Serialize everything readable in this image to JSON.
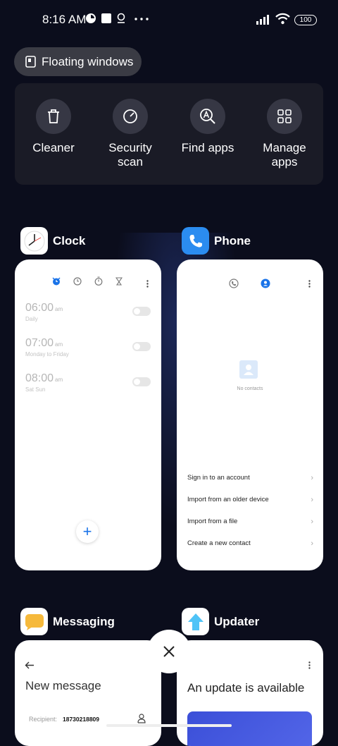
{
  "status_bar": {
    "time": "8:16 AM",
    "battery": "100"
  },
  "floating_windows": {
    "label": "Floating windows"
  },
  "quick_actions": [
    {
      "label": "Cleaner",
      "icon": "trash-icon"
    },
    {
      "label": "Security\nscan",
      "icon": "security-scan-icon"
    },
    {
      "label": "Find apps",
      "icon": "find-apps-icon"
    },
    {
      "label": "Manage\napps",
      "icon": "grid-icon"
    }
  ],
  "apps": {
    "clock": {
      "name": "Clock",
      "alarms": [
        {
          "time": "06:00",
          "ampm": "am",
          "days": "Daily"
        },
        {
          "time": "07:00",
          "ampm": "am",
          "days": "Monday to Friday"
        },
        {
          "time": "08:00",
          "ampm": "am",
          "days": "Sat Sun"
        }
      ]
    },
    "phone": {
      "name": "Phone",
      "empty_text": "No contacts",
      "options": [
        "Sign in to an account",
        "Import from an older device",
        "Import from a file",
        "Create a new contact"
      ]
    },
    "messaging": {
      "name": "Messaging",
      "title": "New message",
      "recipient_label": "Recipient:",
      "recipient_value": "18730218809"
    },
    "updater": {
      "name": "Updater",
      "title": "An update is available"
    }
  },
  "colors": {
    "accent": "#1a73e8",
    "background": "#0b0d1c",
    "panel": "#1a1b26"
  }
}
